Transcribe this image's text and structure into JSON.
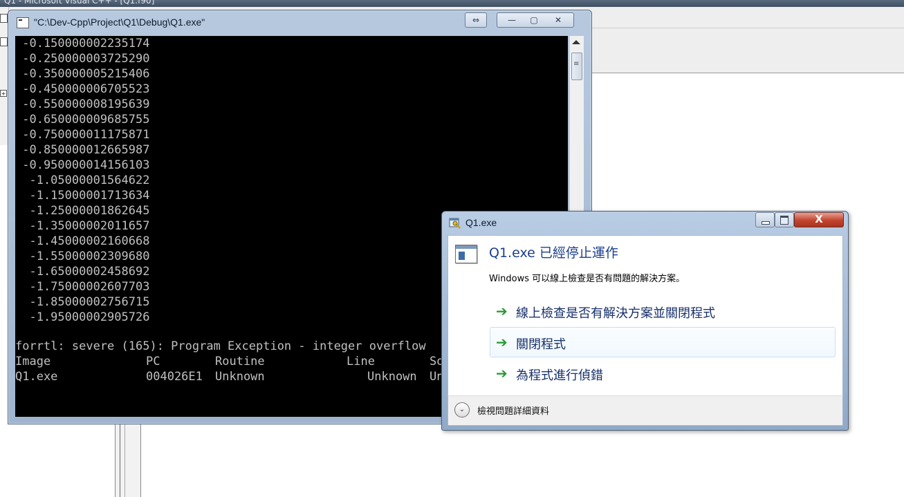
{
  "ide": {
    "title": "Q1 - Microsoft Visual C++ - [Q1.f90]"
  },
  "console": {
    "title": "\"C:\\Dev-Cpp\\Project\\Q1\\Debug\\Q1.exe\"",
    "restore_glyph": "⇔",
    "min_glyph": "—",
    "max_glyph": "▢",
    "close_glyph": "✕",
    "output_lines": [
      " -0.150000002235174",
      " -0.250000003725290",
      " -0.350000005215406",
      " -0.450000006705523",
      " -0.550000008195639",
      " -0.650000009685755",
      " -0.750000011175871",
      " -0.850000012665987",
      " -0.950000014156103",
      "  -1.05000001564622",
      "  -1.15000001713634",
      "  -1.25000001862645",
      "  -1.35000002011657",
      "  -1.45000002160668",
      "  -1.55000002309680",
      "  -1.65000002458692",
      "  -1.75000002607703",
      "  -1.85000002756715",
      "  -1.95000002905726"
    ],
    "error_line": "forrtl: severe (165): Program Exception - integer overflow",
    "trace_header": {
      "image": "Image",
      "pc": "PC",
      "routine": "Routine",
      "line": "Line",
      "source": "So"
    },
    "trace_row": {
      "image": "Q1.exe",
      "pc": "004026E1",
      "routine": "Unknown",
      "line": "Unknown",
      "source": "Un"
    }
  },
  "dialog": {
    "title": "Q1.exe",
    "close_glyph": "X",
    "heading": "Q1.exe 已經停止運作",
    "description": "Windows 可以線上檢查是否有問題的解決方案。",
    "options": [
      {
        "label": "線上檢查是否有解決方案並關閉程式"
      },
      {
        "label": "關閉程式"
      },
      {
        "label": "為程式進行偵錯"
      }
    ],
    "arrow_glyph": "➔",
    "details_label": "檢視問題詳細資料",
    "chevron_glyph": "⌄",
    "colors": {
      "heading": "#1a3e8c",
      "option_arrow": "#2a9a38",
      "close_button": "#c2432d"
    }
  }
}
